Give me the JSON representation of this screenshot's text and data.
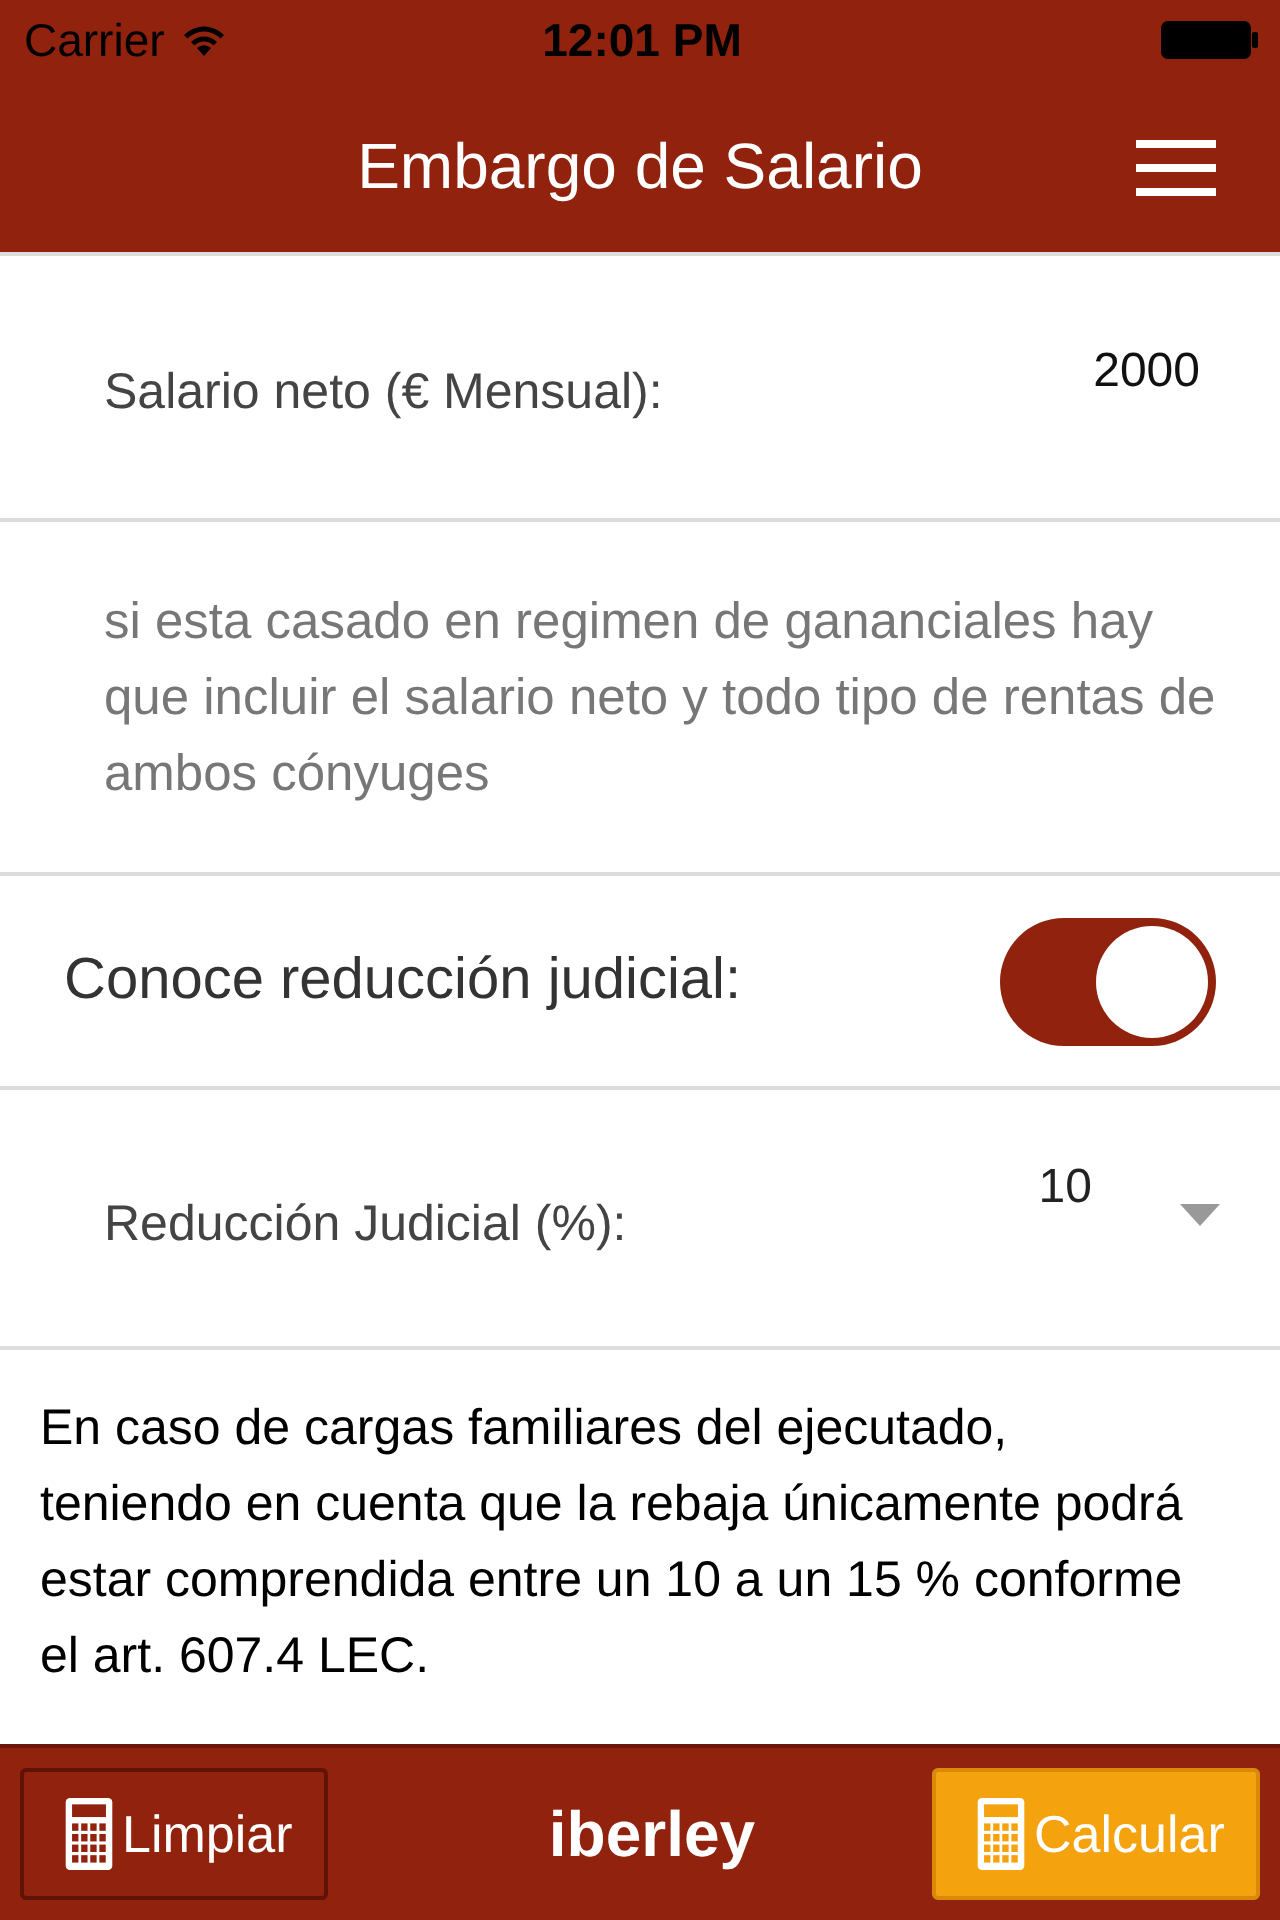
{
  "status_bar": {
    "carrier": "Carrier",
    "time": "12:01 PM"
  },
  "nav": {
    "title": "Embargo de Salario"
  },
  "salary": {
    "label": "Salario neto (€ Mensual):",
    "value": "2000"
  },
  "note": "si esta casado en regimen de gananciales hay que incluir el salario neto y todo tipo de rentas de ambos cónyuges",
  "toggle": {
    "label": "Conoce reducción judicial:",
    "on": true
  },
  "reduction": {
    "label": "Reducción Judicial (%):",
    "value": "10"
  },
  "info": "En caso de cargas familiares del ejecutado, teniendo en cuenta que la rebaja únicamente podrá estar comprendida entre un 10 a un 15 % conforme el art. 607.4 LEC.",
  "footer": {
    "buttons": [
      {
        "label": "Limpiar",
        "kind": "secondary"
      },
      {
        "label": "Calcular",
        "kind": "primary"
      }
    ],
    "brand": "iberley"
  }
}
